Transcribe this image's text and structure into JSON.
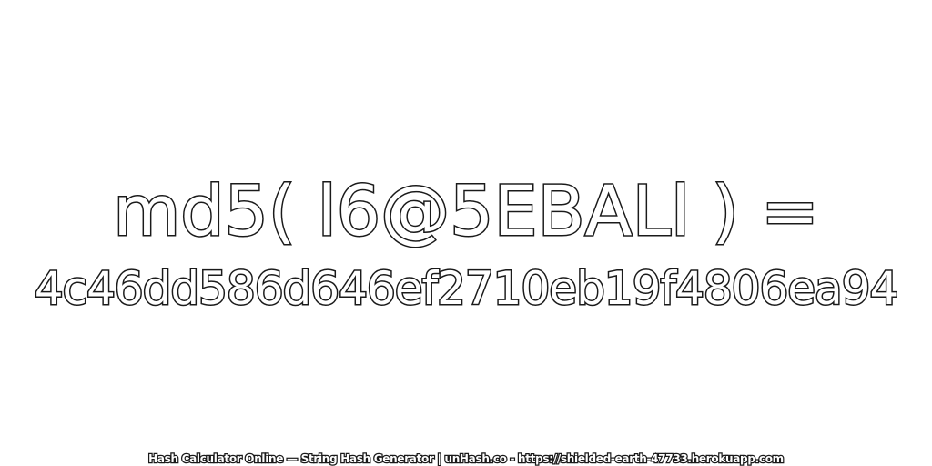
{
  "expression": "md5( l6@5EBALl ) =",
  "hash": "4c46dd586d646ef2710eb19f4806ea94",
  "footer": "Hash Calculator Online — String Hash Generator | unHash.co - https://shielded-earth-47733.herokuapp.com",
  "colors": {
    "background": "#ffffff",
    "text_fill": "#ffffff",
    "text_stroke": "#1a1a1a"
  }
}
